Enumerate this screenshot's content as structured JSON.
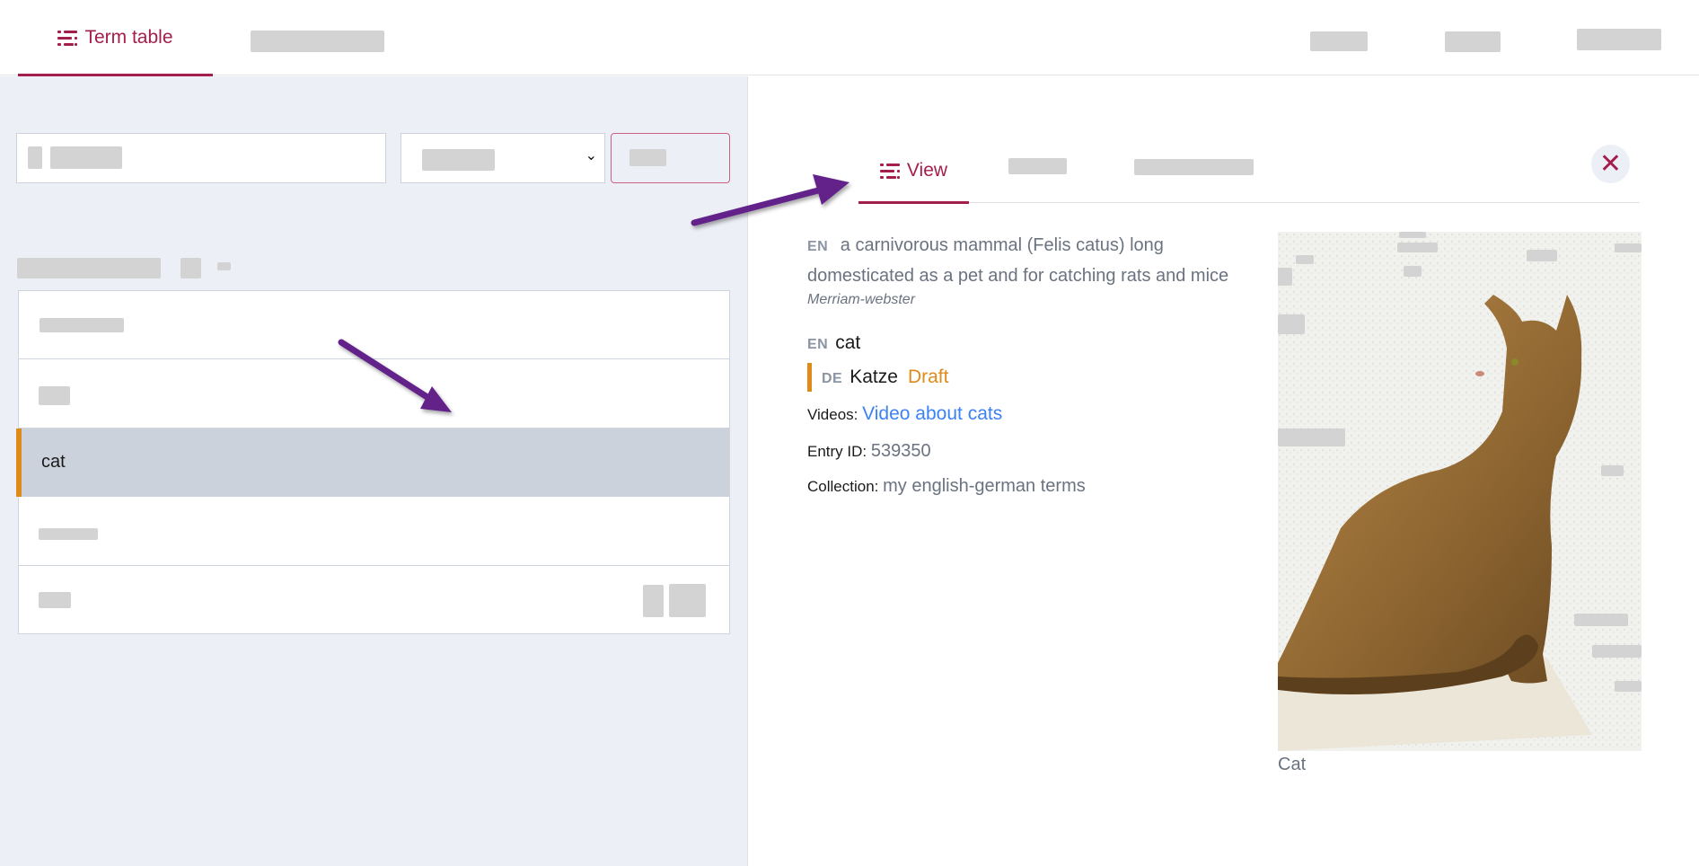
{
  "topnav": {
    "active_tab": {
      "label": "Term table",
      "icon": "list-icon"
    },
    "tabs_redacted": 1,
    "right_items_redacted": 3
  },
  "left_panel": {
    "search": {
      "value": "",
      "placeholder": ""
    },
    "list": {
      "rows": [
        {
          "label": "",
          "redacted": true
        },
        {
          "label": "",
          "redacted": true
        },
        {
          "label": "cat",
          "selected": true
        },
        {
          "label": "",
          "redacted": true
        },
        {
          "label": "",
          "redacted": true
        }
      ]
    }
  },
  "detail": {
    "tabs": [
      {
        "label": "View",
        "icon": "list-icon",
        "active": true
      },
      {
        "label": "",
        "redacted": true
      },
      {
        "label": "",
        "redacted": true
      }
    ],
    "close_icon": "close-icon",
    "definition": {
      "lang": "EN",
      "text": "a carnivorous mammal (Felis catus) long domesticated as a pet and for catching rats and mice",
      "source": "Merriam-webster"
    },
    "terms": [
      {
        "lang": "EN",
        "term": "cat"
      },
      {
        "lang": "DE",
        "term": "Katze",
        "status": "Draft"
      }
    ],
    "videos_label": "Videos:",
    "videos_link": "Video about cats",
    "entry_id_label": "Entry ID:",
    "entry_id": "539350",
    "collection_label": "Collection:",
    "collection": "my english-german terms",
    "image_caption": "Cat"
  },
  "colors": {
    "accent": "#a41e4b",
    "draft": "#e08a1c",
    "link": "#3b82f6",
    "annotation_arrow": "#62238a"
  }
}
